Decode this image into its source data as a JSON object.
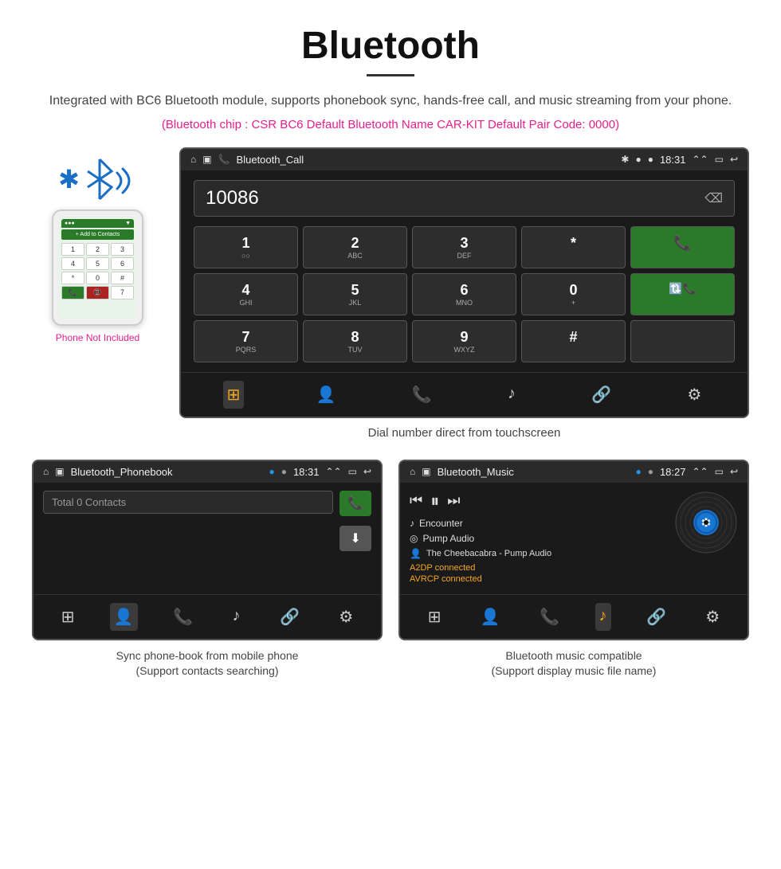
{
  "header": {
    "title": "Bluetooth",
    "description": "Integrated with BC6 Bluetooth module, supports phonebook sync, hands-free call, and music streaming from your phone.",
    "specs": "(Bluetooth chip : CSR BC6    Default Bluetooth Name CAR-KIT    Default Pair Code: 0000)"
  },
  "phone_side": {
    "not_included": "Phone Not Included"
  },
  "car_screen_call": {
    "status_title": "Bluetooth_Call",
    "status_time": "18:31",
    "dial_number": "10086",
    "keypad": [
      {
        "main": "1",
        "sub": "○○"
      },
      {
        "main": "2",
        "sub": "ABC"
      },
      {
        "main": "3",
        "sub": "DEF"
      },
      {
        "main": "*",
        "sub": ""
      },
      {
        "main": "☎",
        "sub": "",
        "type": "green"
      },
      {
        "main": "4",
        "sub": "GHI"
      },
      {
        "main": "5",
        "sub": "JKL"
      },
      {
        "main": "6",
        "sub": "MNO"
      },
      {
        "main": "0",
        "sub": "+"
      },
      {
        "main": "☎",
        "sub": "",
        "type": "green"
      },
      {
        "main": "7",
        "sub": "PQRS"
      },
      {
        "main": "8",
        "sub": "TUV"
      },
      {
        "main": "9",
        "sub": "WXYZ"
      },
      {
        "main": "#",
        "sub": ""
      },
      {
        "main": "",
        "sub": ""
      }
    ],
    "caption": "Dial number direct from touchscreen",
    "toolbar": [
      "⊞",
      "👤",
      "☎",
      "♪",
      "🔗",
      "⚙"
    ]
  },
  "phonebook_screen": {
    "status_title": "Bluetooth_Phonebook",
    "status_time": "18:31",
    "search_placeholder": "Total 0 Contacts",
    "caption_line1": "Sync phone-book from mobile phone",
    "caption_line2": "(Support contacts searching)"
  },
  "music_screen": {
    "status_title": "Bluetooth_Music",
    "status_time": "18:27",
    "track1_icon": "♪",
    "track1": "Encounter",
    "track2_icon": "○",
    "track2": "Pump Audio",
    "track3_icon": "👤",
    "track3": "The Cheebacabra - Pump Audio",
    "status1": "A2DP connected",
    "status2": "AVRCP connected",
    "caption_line1": "Bluetooth music compatible",
    "caption_line2": "(Support display music file name)"
  }
}
